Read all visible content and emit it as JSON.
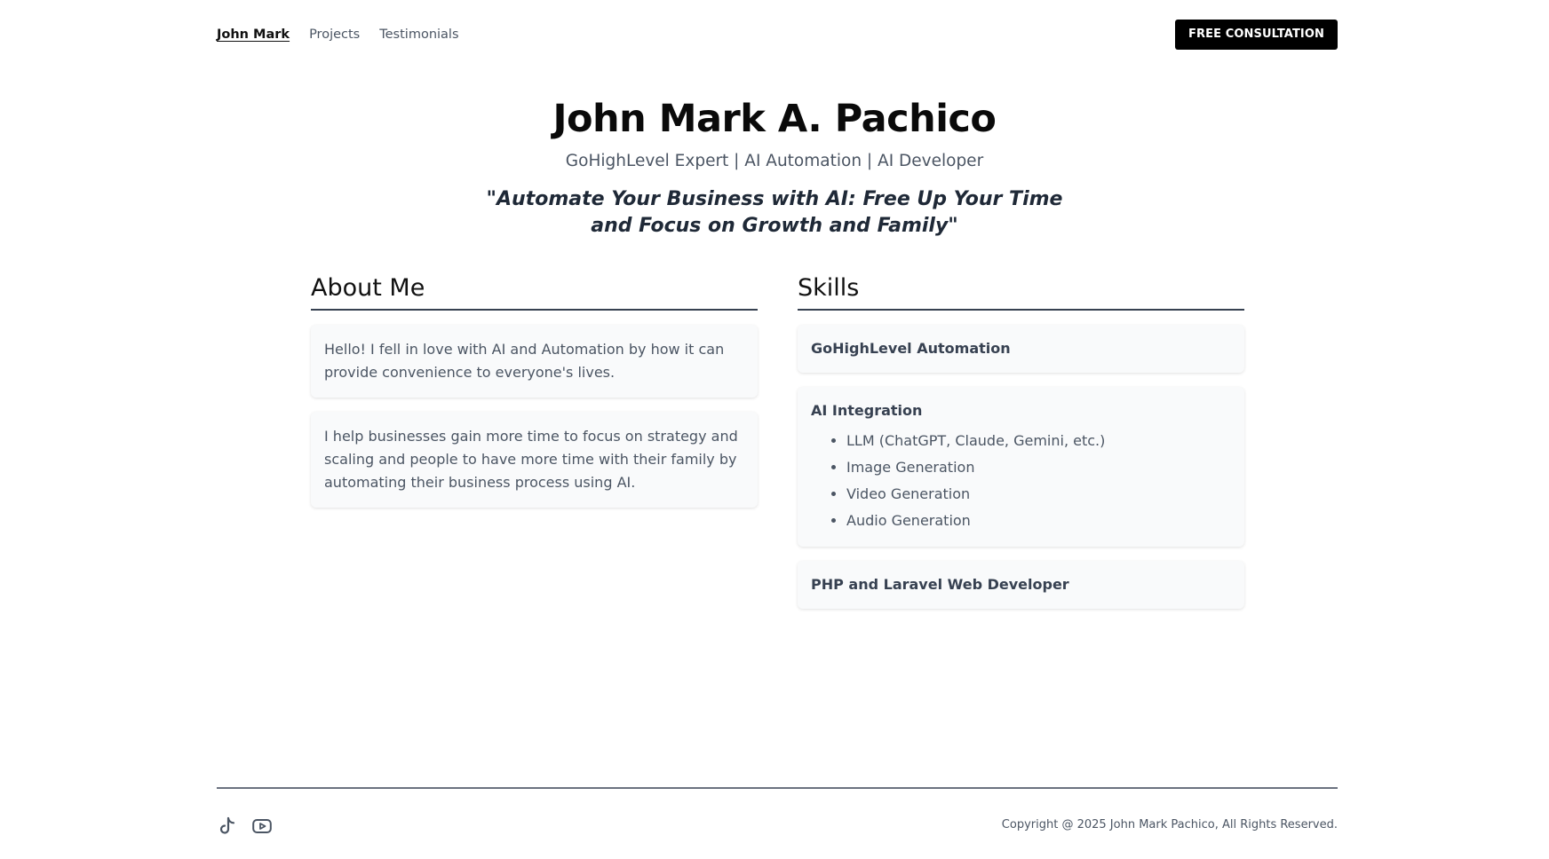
{
  "nav": {
    "brand": "John Mark",
    "links": [
      "Projects",
      "Testimonials"
    ],
    "cta_label": "FREE CONSULTATION"
  },
  "hero": {
    "name": "John Mark A. Pachico",
    "subtitle": "GoHighLevel Expert | AI Automation | AI Developer",
    "quote": "\"Automate Your Business with AI: Free Up Your Time and Focus on Growth and Family\""
  },
  "about": {
    "heading": "About Me",
    "paragraphs": [
      "Hello! I fell in love with AI and Automation by how it can provide convenience to everyone's lives.",
      "I help businesses gain more time to focus on strategy and scaling and people to have more time with their family by automating their business process using AI."
    ]
  },
  "skills": {
    "heading": "Skills",
    "items": [
      {
        "title": "GoHighLevel Automation"
      },
      {
        "title": "AI Integration",
        "sub": [
          "LLM (ChatGPT, Claude, Gemini, etc.)",
          "Image Generation",
          "Video Generation",
          "Audio Generation"
        ]
      },
      {
        "title": "PHP and Laravel Web Developer"
      }
    ]
  },
  "footer": {
    "icons": [
      "tiktok-icon",
      "youtube-icon"
    ],
    "copyright": "Copyright @ 2025 John Mark Pachico, All Rights Reserved."
  }
}
